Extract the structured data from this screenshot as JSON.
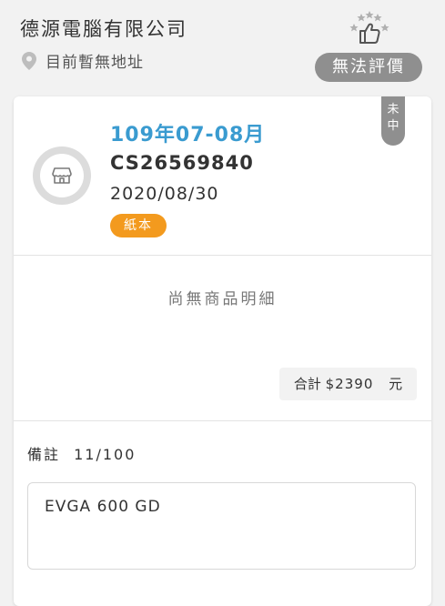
{
  "header": {
    "store_name": "德源電腦有限公司",
    "address": "目前暫無地址",
    "rating_button": "無法評價",
    "icons": {
      "location": "location-pin-icon",
      "rating": "thumbs-up-stars-icon"
    }
  },
  "invoice": {
    "period": "109年07-08月",
    "number": "CS26569840",
    "date": "2020/08/30",
    "type_badge": "紙本",
    "status": "未中",
    "store_icon": "store-icon"
  },
  "items": {
    "empty_text": "尚無商品明細",
    "total_label": "合計",
    "total_amount": "$2390",
    "total_unit": "元"
  },
  "note": {
    "label": "備註",
    "count": "11/100",
    "value": "EVGA 600 GD"
  },
  "colors": {
    "period": "#3a9bd0",
    "badge": "#f39a1e",
    "status_tag": "#8f8f8f",
    "rating_button": "#8f8f8f"
  }
}
